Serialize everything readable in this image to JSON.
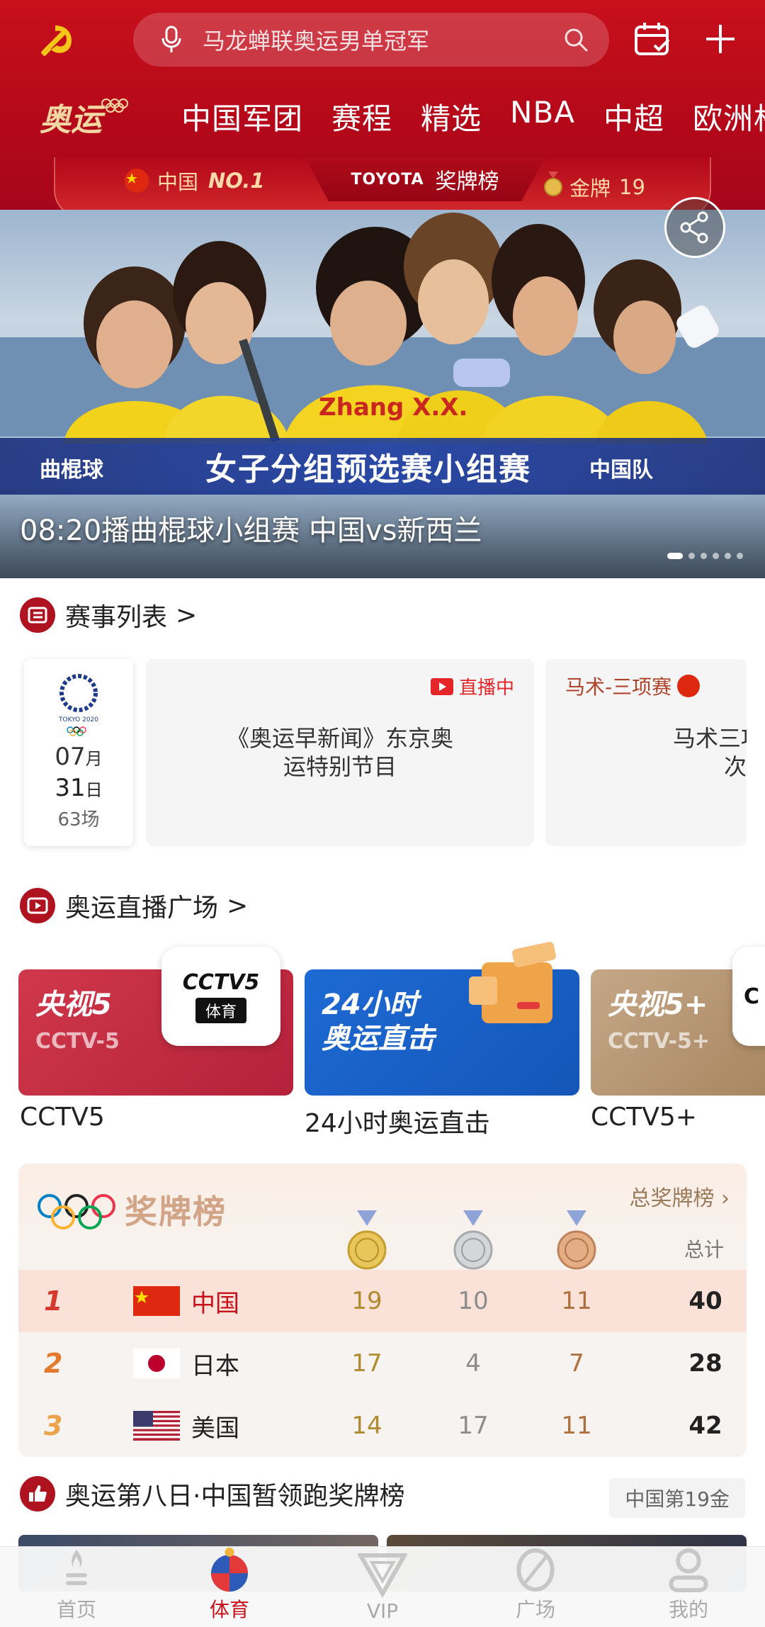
{
  "header": {
    "search_placeholder": "马龙蝉联奥运男单冠军",
    "tabs": [
      "中国军团",
      "赛程",
      "精选",
      "NBA",
      "中超",
      "欧洲杯"
    ]
  },
  "medal_bar": {
    "country": "中国",
    "rank": "NO.1",
    "sponsor": "TOYOTA",
    "title": "奖牌榜",
    "gold_label": "金牌",
    "gold_count": "19"
  },
  "banner": {
    "strip_left": "曲棍球",
    "strip_center": "女子分组预选赛小组赛",
    "strip_right": "中国队",
    "caption": "08:20播曲棍球小组赛 中国vs新西兰",
    "jersey_text": "Zhang X.X.",
    "slide_count": 6,
    "active_slide": 0
  },
  "schedule": {
    "title": "赛事列表",
    "arrow": ">",
    "date": {
      "logo_text": "TOKYO 2020",
      "month": "07",
      "month_unit": "月",
      "day": "31",
      "day_unit": "日",
      "count": "63场"
    },
    "cards": [
      {
        "status": "直播中",
        "desc_line1": "《奥运早新闻》东京奥",
        "desc_line2": "运特别节目"
      },
      {
        "tag": "马术-三项赛",
        "desc_line1": "马术三项赛",
        "desc_line2": "次日第"
      }
    ]
  },
  "live": {
    "title": "奥运直播广场",
    "arrow": ">",
    "channels": [
      {
        "name": "央视5",
        "sub": "CCTV-5",
        "label": "CCTV5",
        "color": "#c8283f",
        "logo_top": "CCTV5",
        "logo_bottom": "体育"
      },
      {
        "name_line1": "24小时",
        "name_line2": "奥运直击",
        "label": "24小时奥运直击",
        "color": "#1b5fc4"
      },
      {
        "name": "央视5+",
        "sub": "CCTV-5+",
        "label": "CCTV5+",
        "color": "#b89a78",
        "logo_top": "C"
      }
    ]
  },
  "medals": {
    "title": "奖牌榜",
    "total_link": "总奖牌榜",
    "total_header": "总计",
    "rows": [
      {
        "rank": "1",
        "country": "中国",
        "gold": "19",
        "silver": "10",
        "bronze": "11",
        "total": "40"
      },
      {
        "rank": "2",
        "country": "日本",
        "gold": "17",
        "silver": "4",
        "bronze": "7",
        "total": "28"
      },
      {
        "rank": "3",
        "country": "美国",
        "gold": "14",
        "silver": "17",
        "bronze": "11",
        "total": "42"
      }
    ]
  },
  "news": {
    "title": "奥运第八日·中国暂领跑奖牌榜",
    "badge": "中国第19金"
  },
  "nav": [
    {
      "label": "首页",
      "icon": "torch-icon"
    },
    {
      "label": "体育",
      "icon": "sports-ball-icon"
    },
    {
      "label": "VIP",
      "icon": "vip-icon"
    },
    {
      "label": "广场",
      "icon": "leaf-icon"
    },
    {
      "label": "我的",
      "icon": "user-icon"
    }
  ],
  "colors": {
    "brand_red": "#c8101b",
    "gold": "#b08a2e",
    "silver": "#8c8c8c",
    "bronze": "#b0703e"
  }
}
